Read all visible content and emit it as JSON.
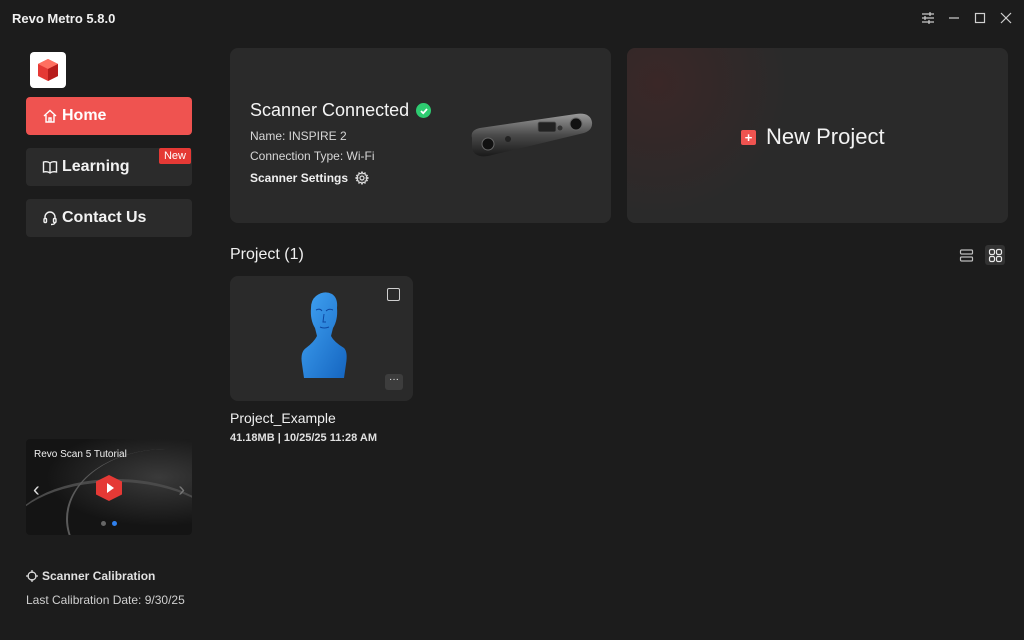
{
  "window": {
    "title": "Revo Metro 5.8.0",
    "controls": [
      "settings-sliders-icon",
      "minimize-icon",
      "maximize-icon",
      "close-icon"
    ]
  },
  "sidebar": {
    "items": [
      {
        "label": "Home",
        "icon": "home-icon",
        "active": true
      },
      {
        "label": "Learning",
        "icon": "book-icon",
        "badge": "New"
      },
      {
        "label": "Contact Us",
        "icon": "headset-icon"
      }
    ],
    "tutorial": {
      "title": "Revo Scan 5 Tutorial"
    },
    "calibration_label": "Scanner Calibration",
    "last_calibration": "Last Calibration Date: 9/30/25"
  },
  "scanner": {
    "status": "Scanner Connected",
    "name": "Name: INSPIRE 2",
    "connection": "Connection Type: Wi-Fi",
    "settings_label": "Scanner Settings"
  },
  "new_project": {
    "label": "New Project"
  },
  "projects": {
    "heading": "Project (1)",
    "items": [
      {
        "name": "Project_Example",
        "meta": "41.18MB | 10/25/25 11:28 AM"
      }
    ]
  },
  "colors": {
    "accent": "#ef5350",
    "background": "#1c1c1c",
    "card": "#2a2a2a",
    "success": "#2ecc71",
    "model_blue": "#1e88e5"
  }
}
